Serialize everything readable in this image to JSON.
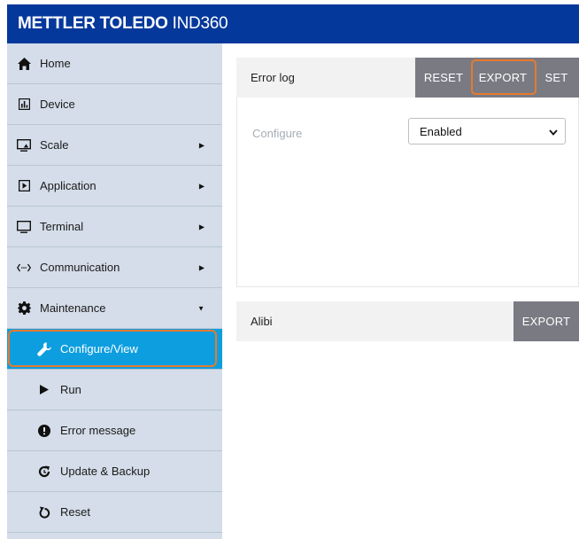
{
  "header": {
    "brand": "METTLER TOLEDO",
    "model": "IND360"
  },
  "sidebar": {
    "items": [
      {
        "label": "Home",
        "icon": "home-icon"
      },
      {
        "label": "Device",
        "icon": "chart-icon"
      },
      {
        "label": "Scale",
        "icon": "monitor-icon",
        "caret": "▶"
      },
      {
        "label": "Application",
        "icon": "play-box-icon",
        "caret": "▶"
      },
      {
        "label": "Terminal",
        "icon": "monitor-icon",
        "caret": "▶"
      },
      {
        "label": "Communication",
        "icon": "arrows-icon",
        "caret": "▶"
      },
      {
        "label": "Maintenance",
        "icon": "gear-icon",
        "caret": "▼"
      }
    ],
    "subitems": [
      {
        "label": "Configure/View",
        "icon": "wrench-icon"
      },
      {
        "label": "Run",
        "icon": "play-icon"
      },
      {
        "label": "Error message",
        "icon": "alert-icon"
      },
      {
        "label": "Update & Backup",
        "icon": "refresh-icon"
      },
      {
        "label": "Reset",
        "icon": "reset-icon"
      }
    ]
  },
  "error_log": {
    "title": "Error log",
    "reset_label": "RESET",
    "export_label": "EXPORT",
    "set_label": "SET",
    "configure_label": "Configure",
    "configure_value": "Enabled"
  },
  "alibi": {
    "title": "Alibi",
    "export_label": "EXPORT"
  },
  "colors": {
    "topbar": "#04389b",
    "sidebar": "#d4dde9",
    "active": "#0d9ee0",
    "button": "#7a7a83",
    "highlight": "#e67a2e"
  }
}
